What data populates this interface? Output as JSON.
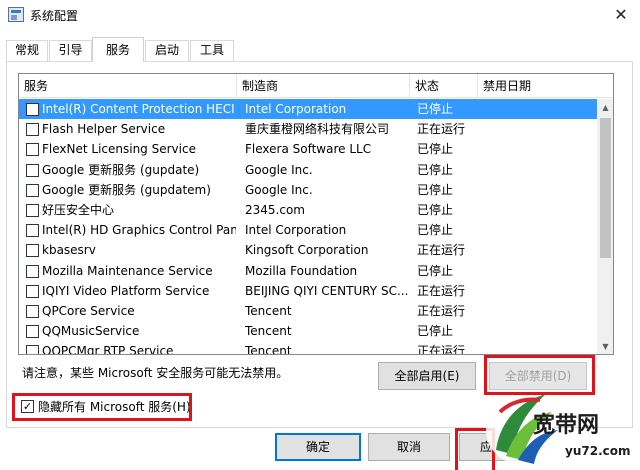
{
  "window": {
    "title": "系统配置",
    "close_glyph": "✕"
  },
  "tabs": [
    {
      "label": "常规",
      "active": false
    },
    {
      "label": "引导",
      "active": false
    },
    {
      "label": "服务",
      "active": true
    },
    {
      "label": "启动",
      "active": false
    },
    {
      "label": "工具",
      "active": false
    }
  ],
  "services": {
    "columns": [
      "服务",
      "制造商",
      "状态",
      "禁用日期"
    ],
    "rows": [
      {
        "service": "Intel(R) Content Protection HECI ...",
        "vendor": "Intel Corporation",
        "status": "已停止",
        "selected": true
      },
      {
        "service": "Flash Helper Service",
        "vendor": "重庆重橙网络科技有限公司",
        "status": "正在运行",
        "selected": false
      },
      {
        "service": "FlexNet Licensing Service",
        "vendor": "Flexera Software LLC",
        "status": "已停止",
        "selected": false
      },
      {
        "service": "Google 更新服务 (gupdate)",
        "vendor": "Google Inc.",
        "status": "已停止",
        "selected": false
      },
      {
        "service": "Google 更新服务 (gupdatem)",
        "vendor": "Google Inc.",
        "status": "已停止",
        "selected": false
      },
      {
        "service": "好压安全中心",
        "vendor": "2345.com",
        "status": "已停止",
        "selected": false
      },
      {
        "service": "Intel(R) HD Graphics Control Pan...",
        "vendor": "Intel Corporation",
        "status": "已停止",
        "selected": false
      },
      {
        "service": "kbasesrv",
        "vendor": "Kingsoft Corporation",
        "status": "正在运行",
        "selected": false
      },
      {
        "service": "Mozilla Maintenance Service",
        "vendor": "Mozilla Foundation",
        "status": "已停止",
        "selected": false
      },
      {
        "service": "IQIYI Video Platform Service",
        "vendor": "BEIJING QIYI CENTURY SC...",
        "status": "正在运行",
        "selected": false
      },
      {
        "service": "QPCore Service",
        "vendor": "Tencent",
        "status": "正在运行",
        "selected": false
      },
      {
        "service": "QQMusicService",
        "vendor": "Tencent",
        "status": "已停止",
        "selected": false
      },
      {
        "service": "QQPCMgr RTP Service",
        "vendor": "Tencent",
        "status": "正在运行",
        "selected": false
      }
    ]
  },
  "note": "请注意，某些 Microsoft 安全服务可能无法禁用。",
  "buttons": {
    "enable_all": "全部启用(E)",
    "disable_all": "全部禁用(D)",
    "ok": "确定",
    "cancel": "取消",
    "apply": "应"
  },
  "hide_ms_services": {
    "label": "隐藏所有 Microsoft 服务(H)",
    "checked": true,
    "check_glyph": "✓"
  },
  "watermark": {
    "brand": "宽带网",
    "url": "yu72.com"
  }
}
